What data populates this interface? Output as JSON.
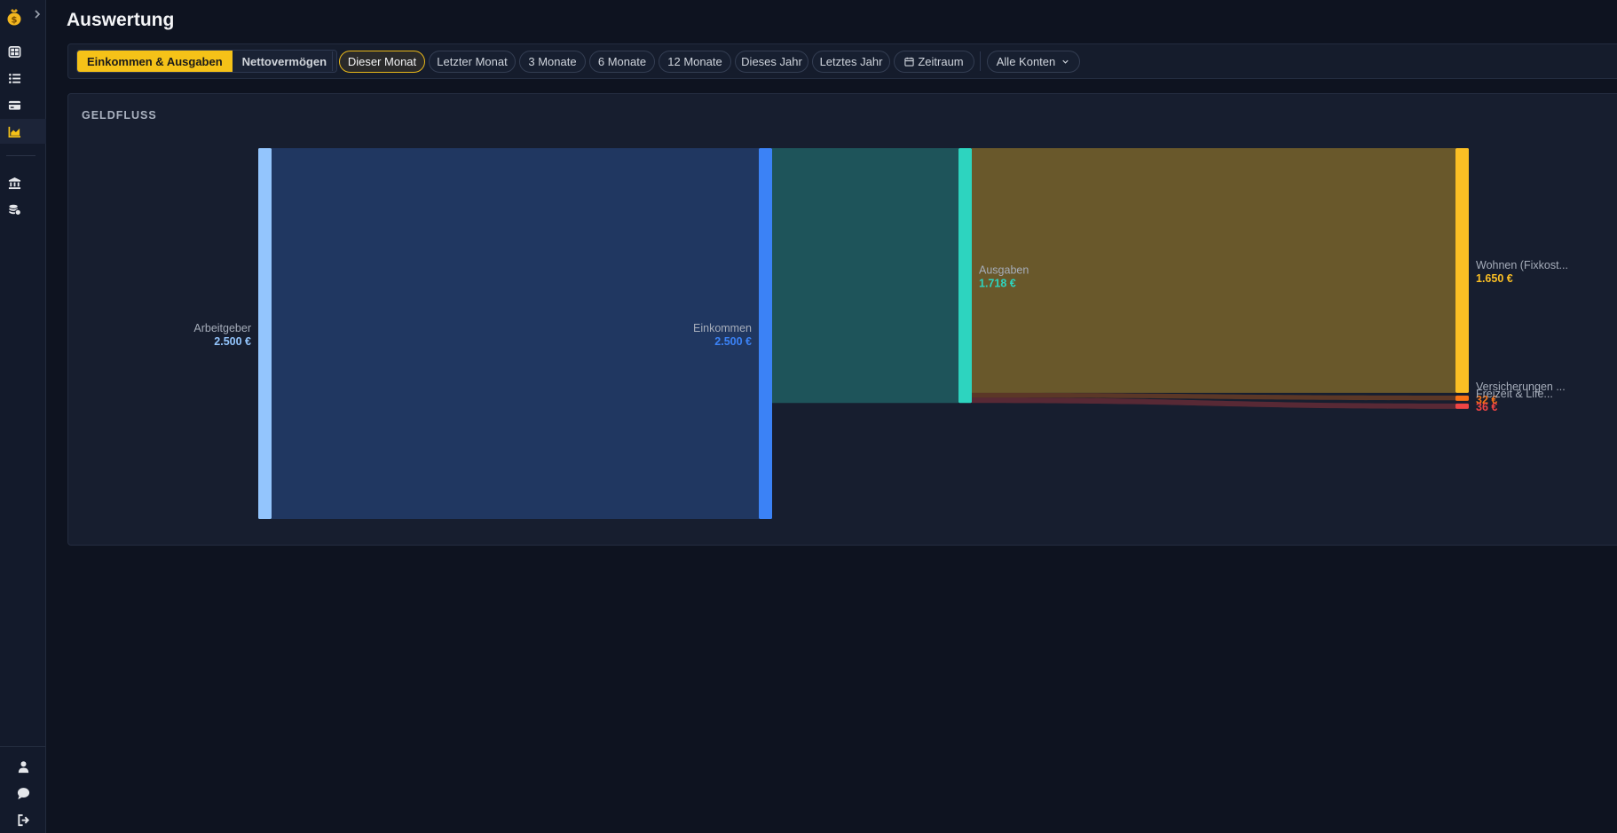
{
  "page": {
    "title": "Auswertung"
  },
  "sidebar": {
    "logo_icon": "money-bag-icon",
    "expand_icon": "chevron-right-icon",
    "items": [
      {
        "name": "dashboard",
        "icon": "grid-icon"
      },
      {
        "name": "transactions",
        "icon": "list-icon"
      },
      {
        "name": "accounts",
        "icon": "credit-card-icon"
      },
      {
        "name": "reports",
        "icon": "chart-icon",
        "active": true
      },
      {
        "name": "institutions",
        "icon": "bank-icon"
      },
      {
        "name": "assets",
        "icon": "coins-icon"
      }
    ],
    "bottom": [
      {
        "name": "profile",
        "icon": "user-icon"
      },
      {
        "name": "feedback",
        "icon": "chat-icon"
      },
      {
        "name": "logout",
        "icon": "logout-icon"
      }
    ]
  },
  "filters": {
    "view_toggle": [
      "Einkommen & Ausgaben",
      "Nettovermögen"
    ],
    "view_active": "Einkommen & Ausgaben",
    "periods": [
      "Dieser Monat",
      "Letzter Monat",
      "3 Monate",
      "6 Monate",
      "12 Monate",
      "Dieses Jahr",
      "Letztes Jahr",
      "Zeitraum"
    ],
    "period_active": "Dieser Monat",
    "accounts": "Alle Konten"
  },
  "card": {
    "title": "GELDFLUSS"
  },
  "colors": {
    "arbeitgeber": "#93c5fd",
    "einkommen": "#3b82f6",
    "ausgaben": "#2dd4bf",
    "wohnen": "#fbbf24",
    "versicherungen": "#f97316",
    "freizeit": "#ef4444",
    "accent": "#f5c218"
  },
  "chart_data": {
    "type": "sankey",
    "title": "GELDFLUSS",
    "nodes": [
      {
        "id": "arbeitgeber",
        "label": "Arbeitgeber",
        "value_label": "2.500 €",
        "value": 2500
      },
      {
        "id": "einkommen",
        "label": "Einkommen",
        "value_label": "2.500 €",
        "value": 2500
      },
      {
        "id": "ausgaben",
        "label": "Ausgaben",
        "value_label": "1.718 €",
        "value": 1718
      },
      {
        "id": "wohnen",
        "label": "Wohnen (Fixkost...",
        "value_label": "1.650 €",
        "value": 1650
      },
      {
        "id": "versicherungen",
        "label": "Versicherungen ...",
        "value_label": "32 €",
        "value": 32
      },
      {
        "id": "freizeit",
        "label": "Freizeit & Life...",
        "value_label": "36 €",
        "value": 36
      }
    ],
    "links": [
      {
        "source": "arbeitgeber",
        "target": "einkommen",
        "value": 2500
      },
      {
        "source": "einkommen",
        "target": "ausgaben",
        "value": 1718
      },
      {
        "source": "ausgaben",
        "target": "wohnen",
        "value": 1650
      },
      {
        "source": "ausgaben",
        "target": "versicherungen",
        "value": 32
      },
      {
        "source": "ausgaben",
        "target": "freizeit",
        "value": 36
      }
    ]
  }
}
